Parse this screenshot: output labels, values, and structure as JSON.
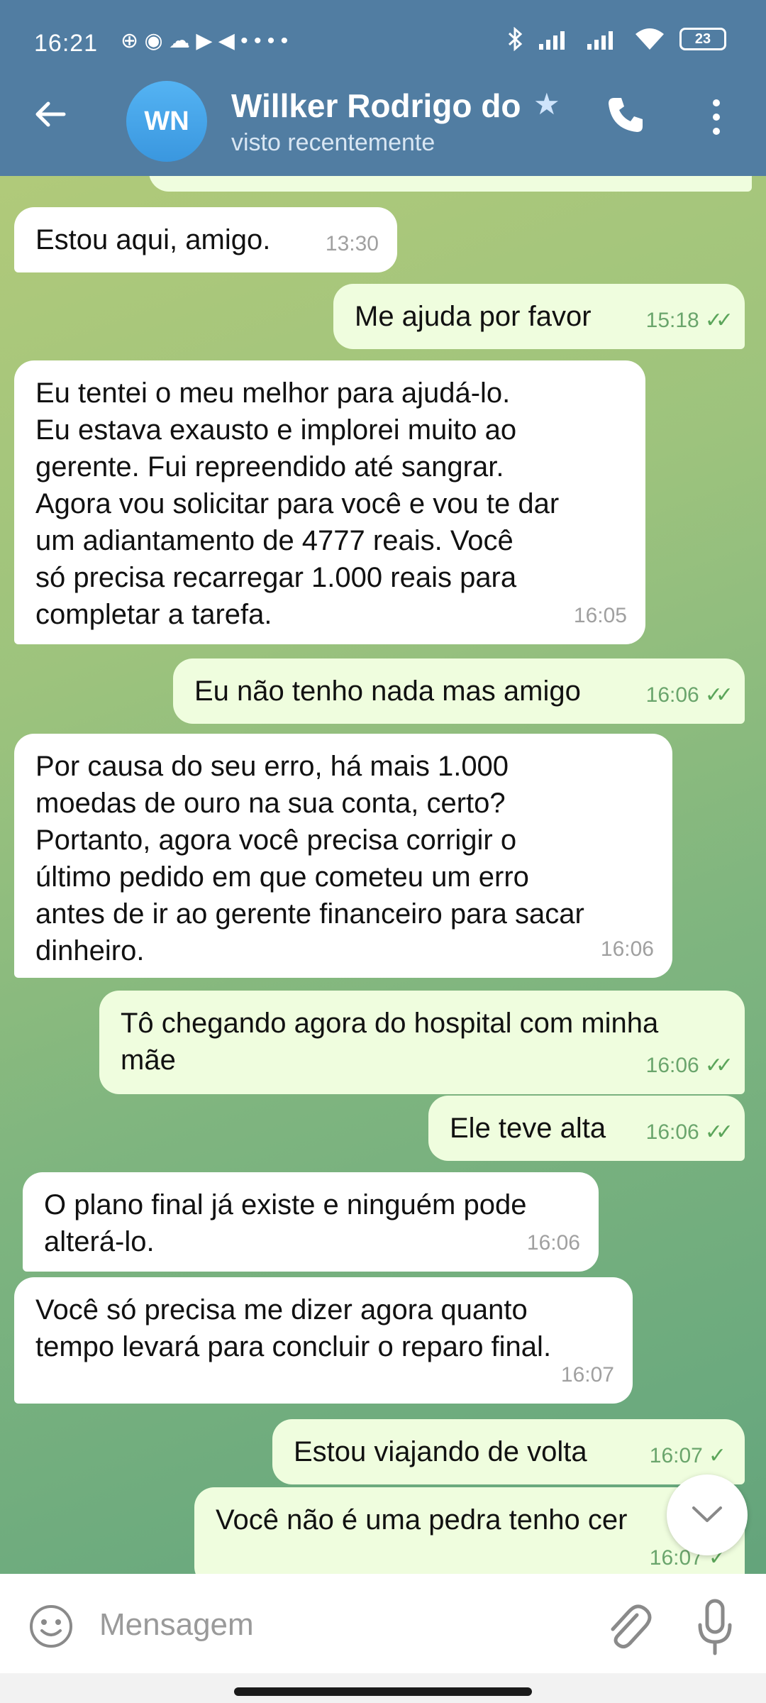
{
  "status_bar": {
    "time": "16:21",
    "notifications": "⊕ ◉ ☁ ▶ ◀ • • • •",
    "battery": "23"
  },
  "header": {
    "back_icon": "arrow-left-icon",
    "avatar_initials": "WN",
    "contact_name": "Willker Rodrigo do",
    "last_seen": "visto recentemente"
  },
  "messages": [
    {
      "dir": "in",
      "text": "Estou aqui, amigo.",
      "time": "13:30"
    },
    {
      "dir": "out",
      "text": "Me ajuda por favor",
      "time": "15:18",
      "status": "read"
    },
    {
      "dir": "in",
      "text": "Eu tentei o meu melhor para ajudá-lo.\nEu estava exausto e implorei muito ao\ngerente. Fui repreendido até sangrar.\nAgora vou solicitar para você e vou te dar\num adiantamento de 4777 reais. Você\nsó precisa recarregar 1.000 reais para\ncompletar a tarefa.",
      "time": "16:05"
    },
    {
      "dir": "out",
      "text": "Eu não tenho nada mas amigo",
      "time": "16:06",
      "status": "read"
    },
    {
      "dir": "in",
      "text": "Por causa do seu erro, há mais 1.000\nmoedas de ouro na sua conta, certo?\nPortanto, agora você precisa corrigir o\núltimo pedido em que cometeu um erro\nantes de ir ao gerente financeiro para sacar\ndinheiro.",
      "time": "16:06"
    },
    {
      "dir": "out",
      "text": "Tô chegando agora do hospital com minha\nmãe",
      "time": "16:06",
      "status": "read"
    },
    {
      "dir": "out",
      "text": "Ele teve alta",
      "time": "16:06",
      "status": "read"
    },
    {
      "dir": "in",
      "text": "O plano final já existe e ninguém pode\nalterá-lo.",
      "time": "16:06"
    },
    {
      "dir": "in",
      "text": "Você só precisa me dizer agora quanto\ntempo levará para concluir o reparo final.",
      "time": "16:07"
    },
    {
      "dir": "out",
      "text": "Estou viajando de volta",
      "time": "16:07",
      "status": "sent"
    },
    {
      "dir": "out",
      "text": "Você não é uma pedra tenho cer",
      "time": "16:07",
      "status": "sent"
    }
  ],
  "input": {
    "placeholder": "Mensagem"
  },
  "colors": {
    "header": "#517da2",
    "incoming_bubble": "#ffffff",
    "outgoing_bubble": "#effdde",
    "tick": "#5ba55a"
  }
}
